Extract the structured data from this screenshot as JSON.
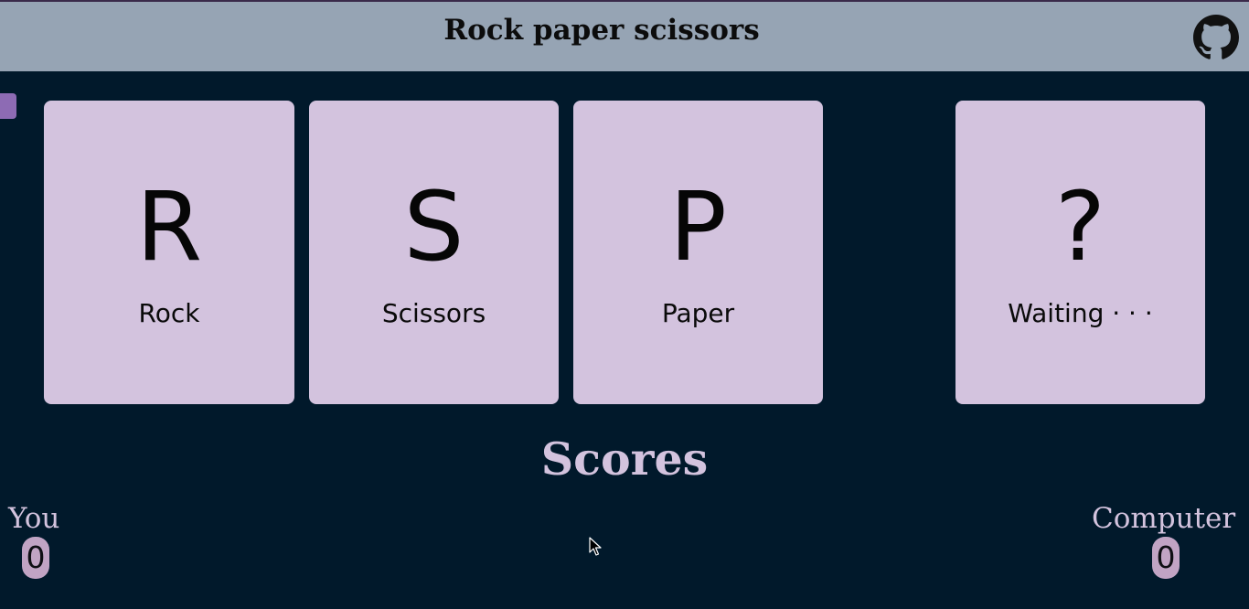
{
  "header": {
    "title": "Rock paper scissors",
    "icon": "github-icon"
  },
  "choices": [
    {
      "letter": "R",
      "label": "Rock"
    },
    {
      "letter": "S",
      "label": "Scissors"
    },
    {
      "letter": "P",
      "label": "Paper"
    }
  ],
  "computer_choice": {
    "letter": "?",
    "label": "Waiting · · ·"
  },
  "scores": {
    "title": "Scores",
    "you_label": "You",
    "you_score": "0",
    "computer_label": "Computer",
    "computer_score": "0"
  },
  "colors": {
    "background": "#01192b",
    "header": "#96a4b4",
    "card": "#d3c3de",
    "accent": "#8d6bb4",
    "badge": "#c1a4c4"
  }
}
